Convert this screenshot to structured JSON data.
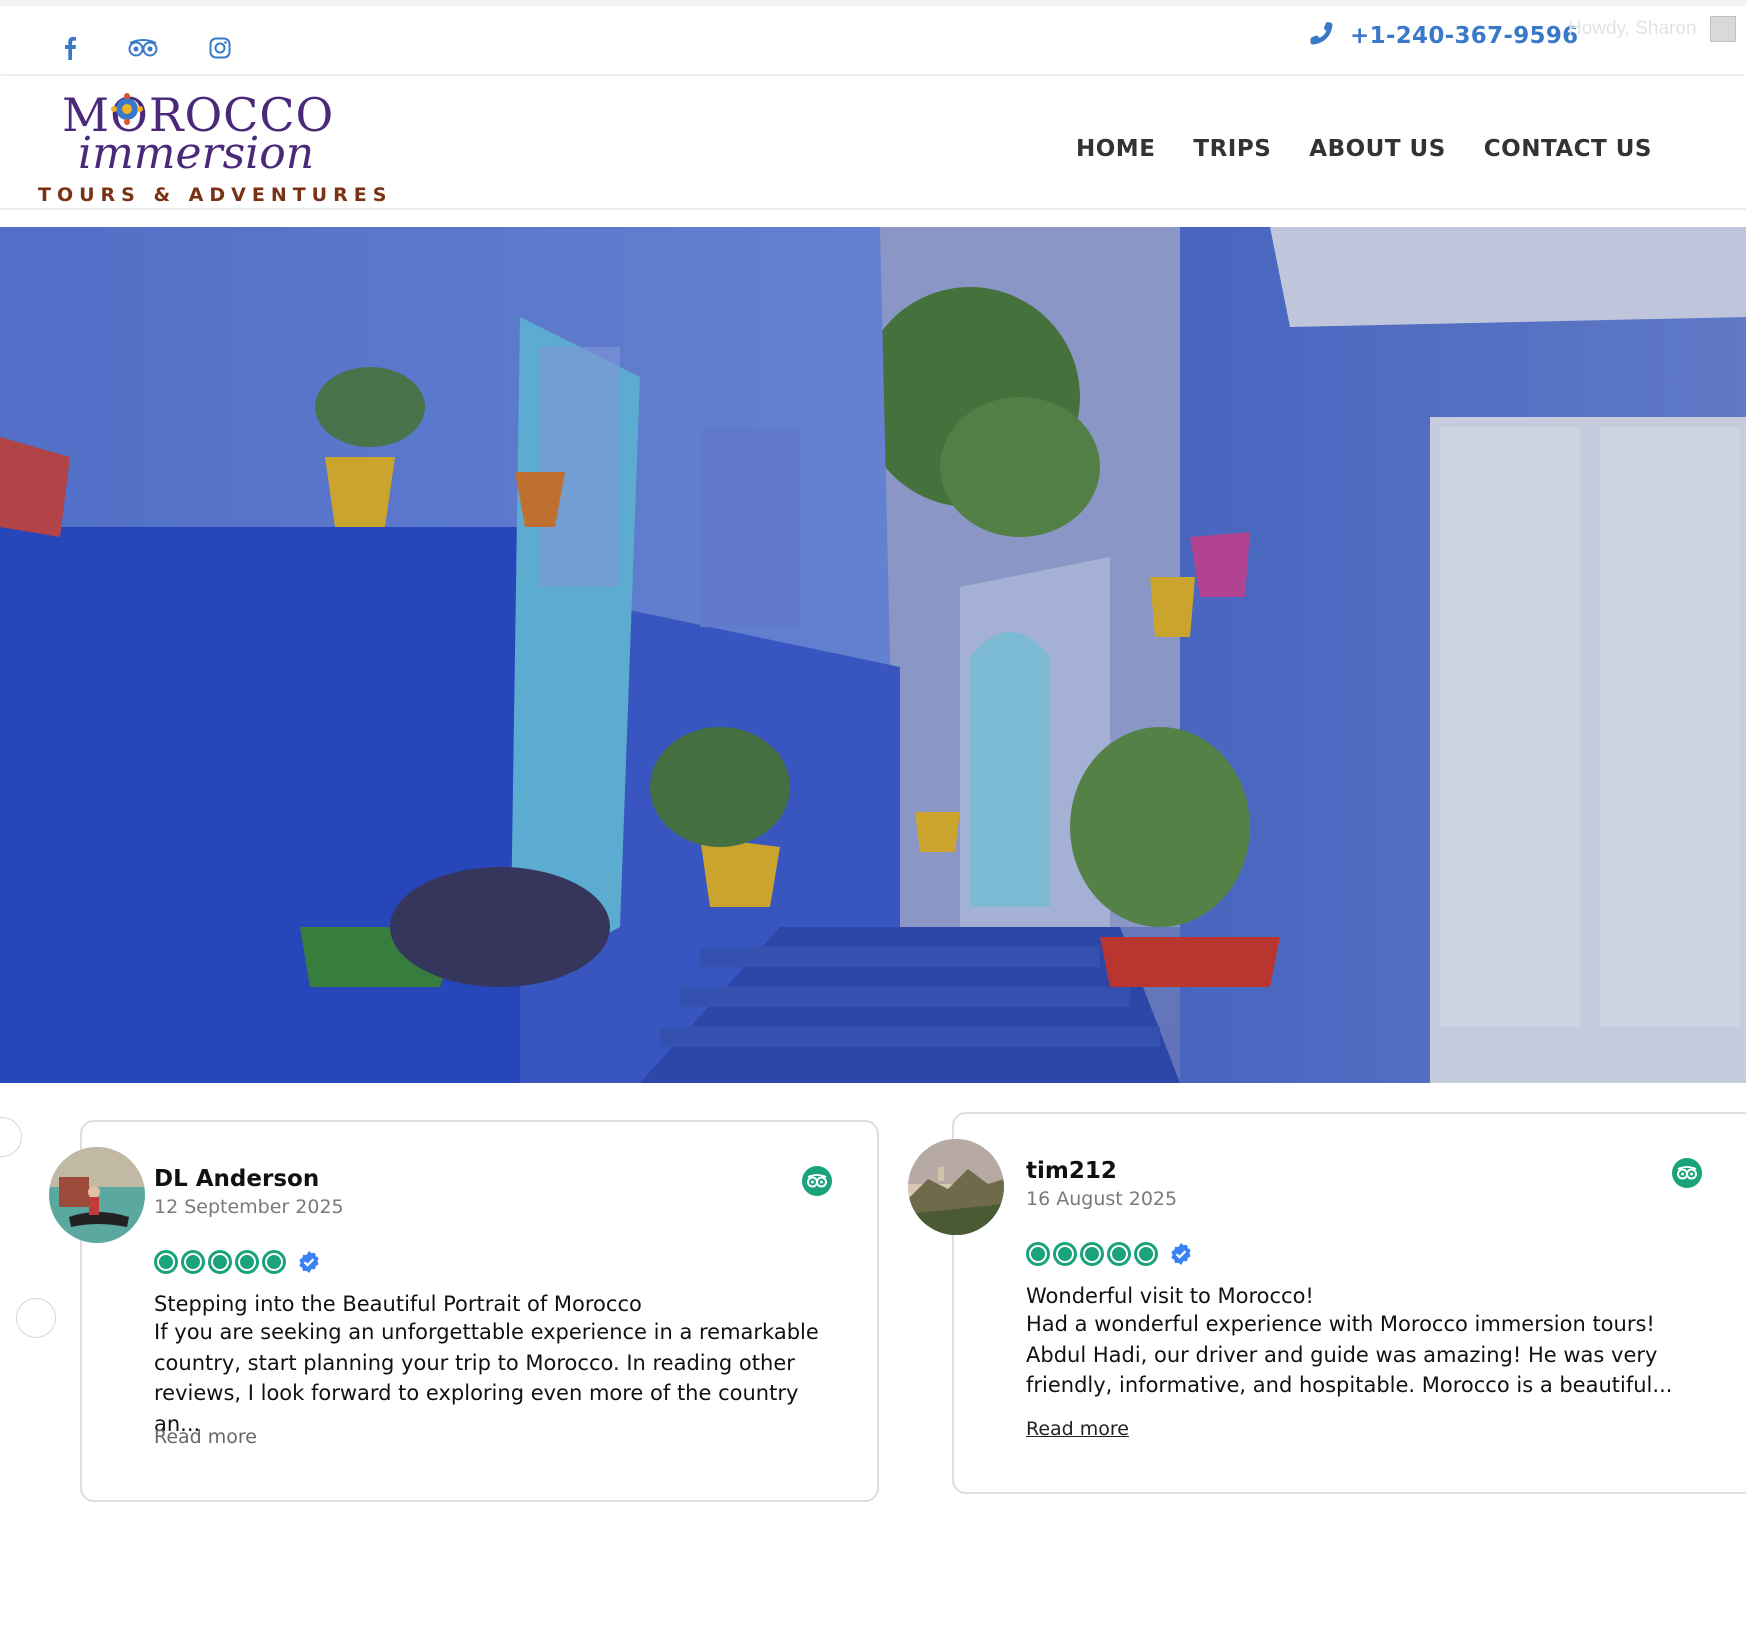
{
  "topbar": {
    "social": [
      {
        "name": "facebook-icon"
      },
      {
        "name": "tripadvisor-icon"
      },
      {
        "name": "instagram-icon"
      }
    ],
    "phone": "+1-240-367-9596",
    "howdy": "Howdy, Sharon"
  },
  "header": {
    "logo": {
      "main": "MOROCCO",
      "script": "immersion",
      "sub": "TOURS & ADVENTURES"
    },
    "nav": [
      "HOME",
      "TRIPS",
      "ABOUT US",
      "CONTACT US"
    ]
  },
  "colors": {
    "accent": "#3a79c8",
    "tripadvisor": "#1aa37a",
    "logo_purple": "#4a2a78",
    "logo_brown": "#7a3215"
  },
  "reviews": [
    {
      "name": "DL Anderson",
      "date": "12 September 2025",
      "rating": 5,
      "title": "Stepping into the Beautiful Portrait of Morocco",
      "body": "If you are seeking an unforgettable experience in a remarkable country, start planning your trip to Morocco. In reading other reviews, I look forward to exploring even more of the country an...",
      "read_more": "Read more"
    },
    {
      "name": "tim212",
      "date": "16 August 2025",
      "rating": 5,
      "title": "Wonderful visit to Morocco!",
      "body": "Had a wonderful experience with Morocco immersion tours! Abdul Hadi, our driver and guide was amazing! He was very friendly, informative, and hospitable. Morocco is a beautiful...",
      "read_more": "Read more"
    }
  ]
}
